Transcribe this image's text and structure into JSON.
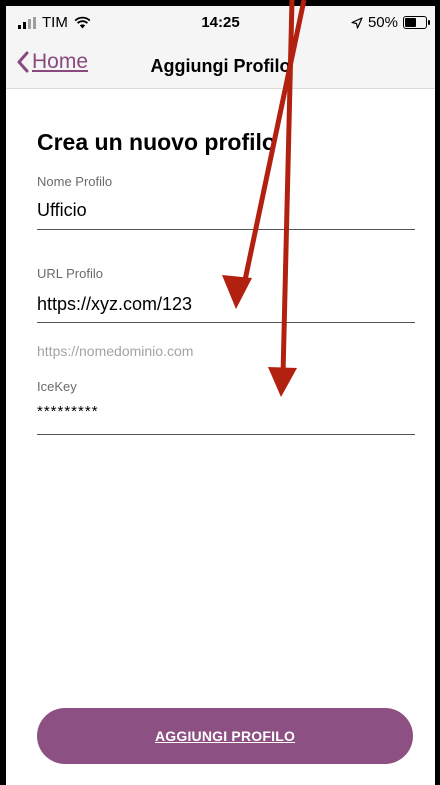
{
  "status_bar": {
    "carrier": "TIM",
    "time": "14:25",
    "battery": "50%"
  },
  "nav": {
    "back_label": "Home",
    "title": "Aggiungi Profilo"
  },
  "form": {
    "heading": "Crea un nuovo profilo",
    "name_label": "Nome Profilo",
    "name_value": "Ufficio",
    "url_label": "URL Profilo",
    "url_value": "https://xyz.com/123",
    "url_hint": "https://nomedominio.com",
    "icekey_label": "IceKey",
    "icekey_value": "*********"
  },
  "submit_label": "AGGIUNGI PROFILO",
  "colors": {
    "accent": "#8c5182",
    "annotation_arrow": "#b22010"
  },
  "icons": [
    "signal-icon",
    "wifi-icon",
    "location-icon",
    "battery-icon",
    "chevron-left-icon"
  ]
}
